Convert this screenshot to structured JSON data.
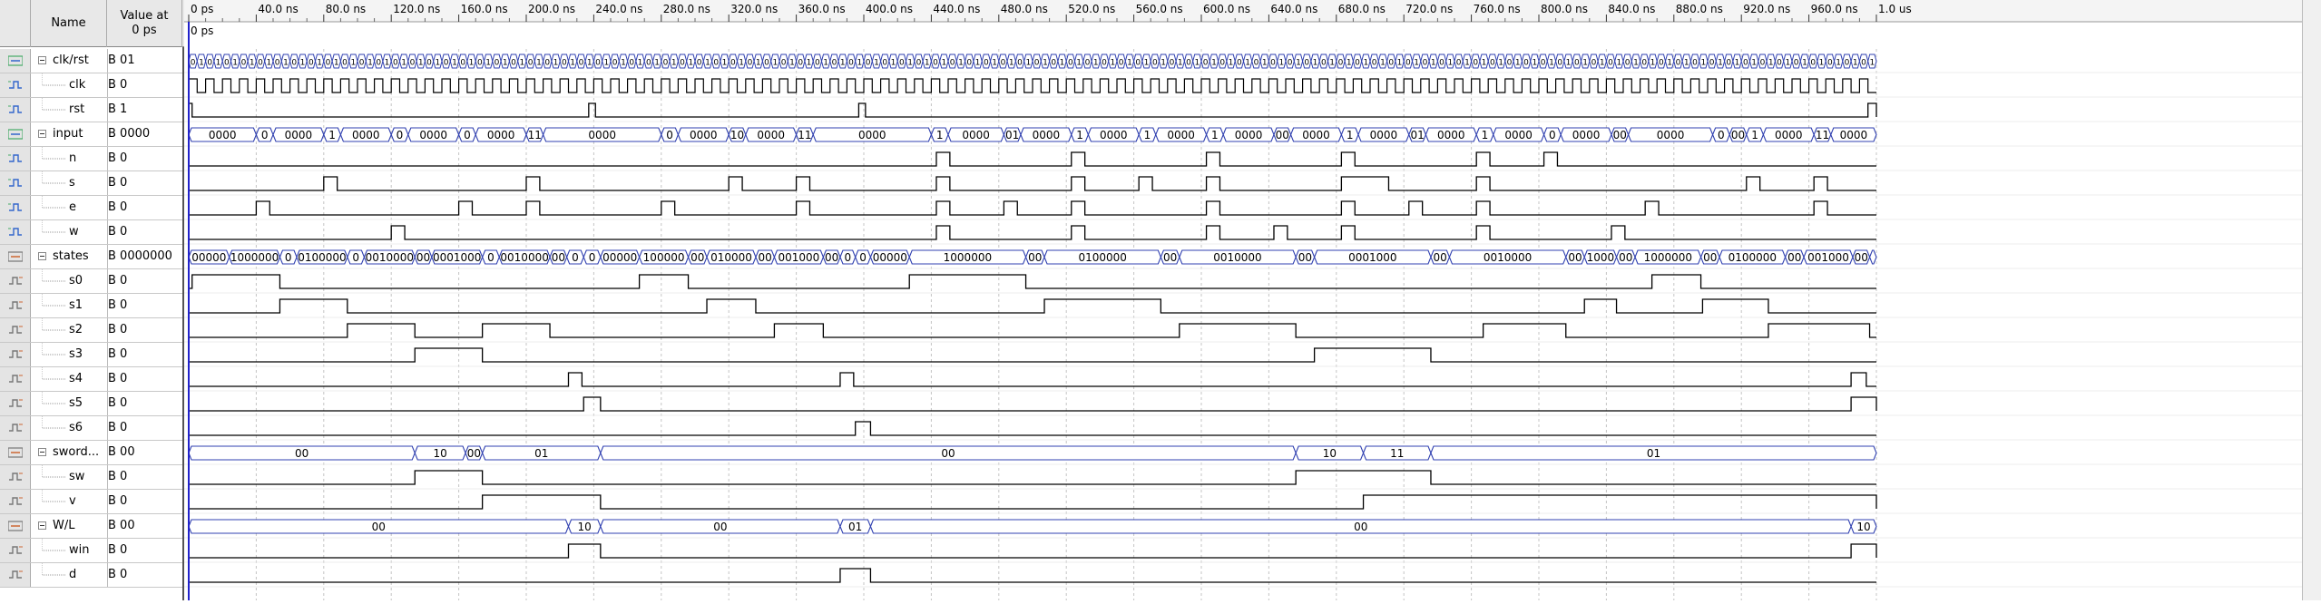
{
  "header": {
    "name_label": "Name",
    "value_label": "Value at\n0 ps"
  },
  "timeline": {
    "ns_per_division": 40,
    "ticks": [
      "0 ps",
      "40.0 ns",
      "80.0 ns",
      "120.0 ns",
      "160.0 ns",
      "200.0 ns",
      "240.0 ns",
      "280.0 ns",
      "320.0 ns",
      "360.0 ns",
      "400.0 ns",
      "440.0 ns",
      "480.0 ns",
      "520.0 ns",
      "560.0 ns",
      "600.0 ns",
      "640.0 ns",
      "680.0 ns",
      "720.0 ns",
      "760.0 ns",
      "800.0 ns",
      "840.0 ns",
      "880.0 ns",
      "920.0 ns",
      "960.0 ns",
      "1.0 us"
    ],
    "cursor_label": "0 ps"
  },
  "signals": [
    {
      "name": "clk/rst",
      "value": "B 01",
      "kind": "bus",
      "group": true,
      "wave": "clkbus"
    },
    {
      "name": "clk",
      "value": "B 0",
      "kind": "input",
      "child": true,
      "wave": "clk"
    },
    {
      "name": "rst",
      "value": "B 1",
      "kind": "input",
      "child": true,
      "wave": "rst"
    },
    {
      "name": "input",
      "value": "B 0000",
      "kind": "bus",
      "group": true,
      "wave": "input"
    },
    {
      "name": "n",
      "value": "B 0",
      "kind": "input",
      "child": true,
      "wave": "n"
    },
    {
      "name": "s",
      "value": "B 0",
      "kind": "input",
      "child": true,
      "wave": "s"
    },
    {
      "name": "e",
      "value": "B 0",
      "kind": "input",
      "child": true,
      "wave": "e"
    },
    {
      "name": "w",
      "value": "B 0",
      "kind": "input",
      "child": true,
      "wave": "w"
    },
    {
      "name": "states",
      "value": "B 0000000",
      "kind": "outbus",
      "group": true,
      "wave": "states"
    },
    {
      "name": "s0",
      "value": "B 0",
      "kind": "output",
      "child": true,
      "wave": "s0"
    },
    {
      "name": "s1",
      "value": "B 0",
      "kind": "output",
      "child": true,
      "wave": "s1"
    },
    {
      "name": "s2",
      "value": "B 0",
      "kind": "output",
      "child": true,
      "wave": "s2"
    },
    {
      "name": "s3",
      "value": "B 0",
      "kind": "output",
      "child": true,
      "wave": "s3"
    },
    {
      "name": "s4",
      "value": "B 0",
      "kind": "output",
      "child": true,
      "wave": "s4"
    },
    {
      "name": "s5",
      "value": "B 0",
      "kind": "output",
      "child": true,
      "wave": "s5"
    },
    {
      "name": "s6",
      "value": "B 0",
      "kind": "output",
      "child": true,
      "wave": "s6"
    },
    {
      "name": "sword...",
      "value": "B 00",
      "kind": "outbus",
      "group": true,
      "wave": "sword"
    },
    {
      "name": "sw",
      "value": "B 0",
      "kind": "output",
      "child": true,
      "wave": "sw"
    },
    {
      "name": "v",
      "value": "B 0",
      "kind": "output",
      "child": true,
      "wave": "v"
    },
    {
      "name": "W/L",
      "value": "B 00",
      "kind": "outbus",
      "group": true,
      "wave": "wl"
    },
    {
      "name": "win",
      "value": "B 0",
      "kind": "output",
      "child": true,
      "wave": "win"
    },
    {
      "name": "d",
      "value": "B 0",
      "kind": "output",
      "child": true,
      "wave": "d"
    }
  ],
  "waves": {
    "clk": {
      "period_ns": 10
    },
    "rst": {
      "highs": [
        [
          0,
          2
        ],
        [
          237,
          241
        ],
        [
          397,
          401
        ],
        [
          995,
          1000
        ]
      ]
    },
    "n": {
      "highs": [
        [
          443,
          451
        ],
        [
          523,
          531
        ],
        [
          603,
          611
        ],
        [
          683,
          691
        ],
        [
          763,
          771
        ],
        [
          803,
          811
        ]
      ]
    },
    "s": {
      "highs": [
        [
          80,
          88
        ],
        [
          200,
          208
        ],
        [
          320,
          328
        ],
        [
          360,
          368
        ],
        [
          443,
          451
        ],
        [
          523,
          531
        ],
        [
          563,
          571
        ],
        [
          603,
          611
        ],
        [
          683,
          711
        ],
        [
          763,
          771
        ],
        [
          923,
          931
        ],
        [
          963,
          971
        ]
      ]
    },
    "e": {
      "highs": [
        [
          40,
          48
        ],
        [
          160,
          168
        ],
        [
          200,
          208
        ],
        [
          280,
          288
        ],
        [
          360,
          368
        ],
        [
          443,
          451
        ],
        [
          483,
          491
        ],
        [
          523,
          531
        ],
        [
          603,
          611
        ],
        [
          683,
          691
        ],
        [
          723,
          731
        ],
        [
          763,
          771
        ],
        [
          863,
          871
        ],
        [
          963,
          971
        ]
      ]
    },
    "w": {
      "highs": [
        [
          120,
          128
        ],
        [
          443,
          451
        ],
        [
          523,
          531
        ],
        [
          603,
          611
        ],
        [
          643,
          651
        ],
        [
          683,
          691
        ],
        [
          763,
          771
        ],
        [
          843,
          851
        ]
      ]
    },
    "s0": {
      "highs": [
        [
          2,
          54
        ],
        [
          267,
          296
        ],
        [
          427,
          496
        ],
        [
          867,
          896
        ]
      ]
    },
    "s1": {
      "highs": [
        [
          54,
          94
        ],
        [
          307,
          336
        ],
        [
          507,
          576
        ],
        [
          827,
          846
        ],
        [
          897,
          936
        ]
      ]
    },
    "s2": {
      "highs": [
        [
          94,
          134
        ],
        [
          174,
          214
        ],
        [
          347,
          376
        ],
        [
          587,
          656
        ],
        [
          767,
          816
        ],
        [
          936,
          996
        ]
      ]
    },
    "s3": {
      "highs": [
        [
          134,
          174
        ],
        [
          667,
          736
        ]
      ]
    },
    "s4": {
      "highs": [
        [
          225,
          233
        ],
        [
          386,
          394
        ],
        [
          985,
          994
        ]
      ]
    },
    "s5": {
      "highs": [
        [
          234,
          244
        ],
        [
          985,
          1000
        ]
      ]
    },
    "s6": {
      "highs": [
        [
          395,
          404
        ]
      ]
    },
    "sw": {
      "highs": [
        [
          134,
          174
        ],
        [
          656,
          736
        ]
      ]
    },
    "v": {
      "highs": [
        [
          174,
          244
        ],
        [
          696,
          1000
        ]
      ]
    },
    "win": {
      "highs": [
        [
          225,
          244
        ],
        [
          985,
          1000
        ]
      ]
    },
    "d": {
      "highs": [
        [
          386,
          404
        ]
      ]
    }
  },
  "buses": {
    "clkbus": {
      "dense": true,
      "label": "01",
      "period_ns": 5
    },
    "input": [
      [
        0,
        "0000"
      ],
      [
        40,
        "01"
      ],
      [
        50,
        "0000"
      ],
      [
        80,
        "10"
      ],
      [
        90,
        "0000"
      ],
      [
        120,
        "00"
      ],
      [
        130,
        "0000"
      ],
      [
        160,
        "01"
      ],
      [
        170,
        "0000"
      ],
      [
        200,
        "11"
      ],
      [
        210,
        "0000"
      ],
      [
        280,
        "01"
      ],
      [
        290,
        "0000"
      ],
      [
        320,
        "10"
      ],
      [
        330,
        "0000"
      ],
      [
        360,
        "11"
      ],
      [
        370,
        "0000"
      ],
      [
        440,
        "11"
      ],
      [
        450,
        "0000"
      ],
      [
        483,
        "01"
      ],
      [
        493,
        "0000"
      ],
      [
        523,
        "11"
      ],
      [
        533,
        "0000"
      ],
      [
        563,
        "10"
      ],
      [
        573,
        "0000"
      ],
      [
        603,
        "11"
      ],
      [
        613,
        "0000"
      ],
      [
        643,
        "00"
      ],
      [
        653,
        "0000"
      ],
      [
        683,
        "11"
      ],
      [
        693,
        "0000"
      ],
      [
        723,
        "01"
      ],
      [
        733,
        "0000"
      ],
      [
        763,
        "11"
      ],
      [
        773,
        "0000"
      ],
      [
        803,
        "00"
      ],
      [
        813,
        "0000"
      ],
      [
        843,
        "00"
      ],
      [
        853,
        "0000"
      ],
      [
        903,
        "01"
      ],
      [
        913,
        "0000"
      ],
      [
        923,
        "10"
      ],
      [
        933,
        "0000"
      ],
      [
        963,
        "11"
      ],
      [
        973,
        "0000"
      ]
    ],
    "states": [
      [
        0,
        "0000000"
      ],
      [
        24,
        "1000000"
      ],
      [
        54,
        "01"
      ],
      [
        64,
        "0100000"
      ],
      [
        94,
        "00"
      ],
      [
        104,
        "0010000"
      ],
      [
        134,
        "00"
      ],
      [
        144,
        "0001000"
      ],
      [
        174,
        "00"
      ],
      [
        184,
        "0010000"
      ],
      [
        214,
        "00"
      ],
      [
        224,
        "0"
      ],
      [
        234,
        "0"
      ],
      [
        244,
        "00000"
      ],
      [
        267,
        "1000000"
      ],
      [
        296,
        "00"
      ],
      [
        307,
        "0100000"
      ],
      [
        336,
        "00"
      ],
      [
        347,
        "0010000"
      ],
      [
        376,
        "00"
      ],
      [
        386,
        "0"
      ],
      [
        395,
        "0"
      ],
      [
        404,
        "00000"
      ],
      [
        427,
        "1000000"
      ],
      [
        496,
        "00"
      ],
      [
        507,
        "0100000"
      ],
      [
        576,
        "00"
      ],
      [
        587,
        "0010000"
      ],
      [
        656,
        "00"
      ],
      [
        667,
        "0001000"
      ],
      [
        736,
        "00"
      ],
      [
        747,
        "0010000"
      ],
      [
        816,
        "00"
      ],
      [
        827,
        "10000"
      ],
      [
        846,
        "00"
      ],
      [
        857,
        "1000000"
      ],
      [
        896,
        "00"
      ],
      [
        907,
        "0100000"
      ],
      [
        946,
        "00"
      ],
      [
        957,
        "0010000"
      ],
      [
        986,
        "00"
      ],
      [
        996,
        "00"
      ]
    ],
    "sword": [
      [
        0,
        "00"
      ],
      [
        134,
        "10"
      ],
      [
        164,
        "00"
      ],
      [
        174,
        "01"
      ],
      [
        244,
        "00"
      ],
      [
        656,
        "10"
      ],
      [
        696,
        "11"
      ],
      [
        736,
        "01"
      ]
    ],
    "wl": [
      [
        0,
        "00"
      ],
      [
        225,
        "10"
      ],
      [
        244,
        "00"
      ],
      [
        386,
        "01"
      ],
      [
        404,
        "00"
      ],
      [
        985,
        "10"
      ]
    ]
  }
}
